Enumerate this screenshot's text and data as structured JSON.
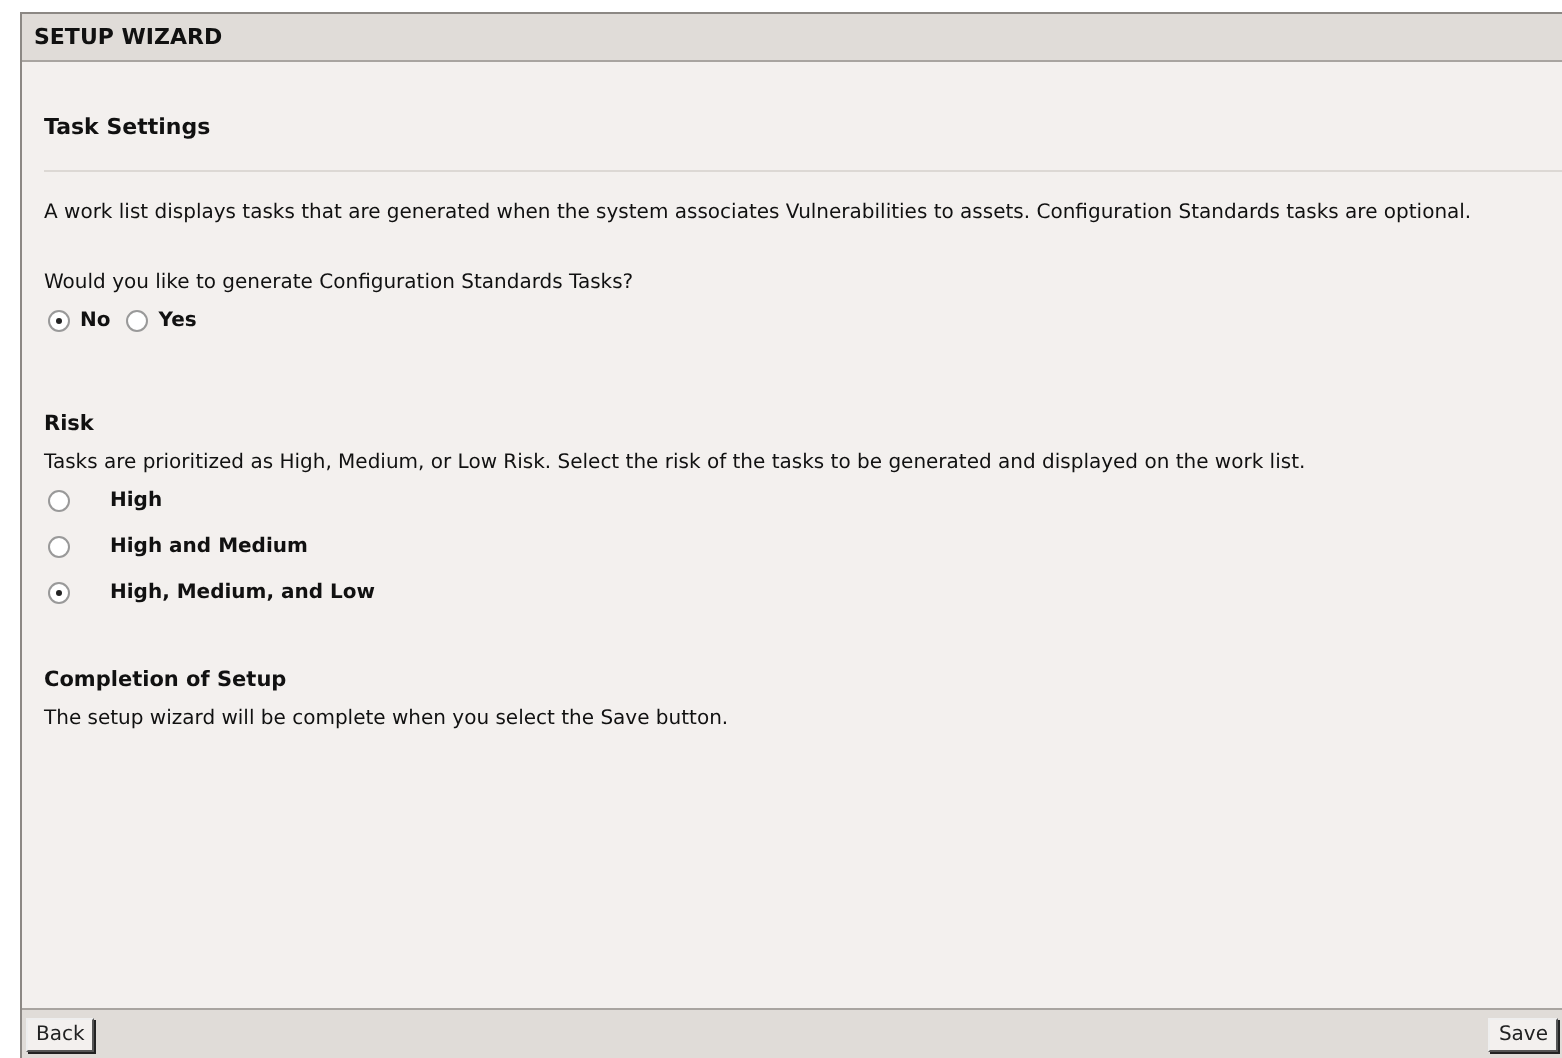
{
  "window": {
    "title": "SETUP WIZARD"
  },
  "heading": "Task Settings",
  "intro": "A work list displays tasks that are generated when the system associates Vulnerabilities to assets. Configuration Standards tasks are optional.",
  "question": "Would you like to generate Configuration Standards Tasks?",
  "config_options": [
    {
      "label": "No",
      "selected": true
    },
    {
      "label": "Yes",
      "selected": false
    }
  ],
  "risk": {
    "title": "Risk",
    "description": "Tasks are prioritized as High, Medium, or Low Risk. Select the risk of the tasks to be generated and displayed on the work list.",
    "options": [
      {
        "label": "High",
        "selected": false
      },
      {
        "label": "High and Medium",
        "selected": false
      },
      {
        "label": "High, Medium, and Low",
        "selected": true
      }
    ]
  },
  "completion": {
    "title": "Completion of Setup",
    "description": "The setup wizard will be complete when you select the Save button."
  },
  "buttons": [
    "Back",
    "Save"
  ]
}
